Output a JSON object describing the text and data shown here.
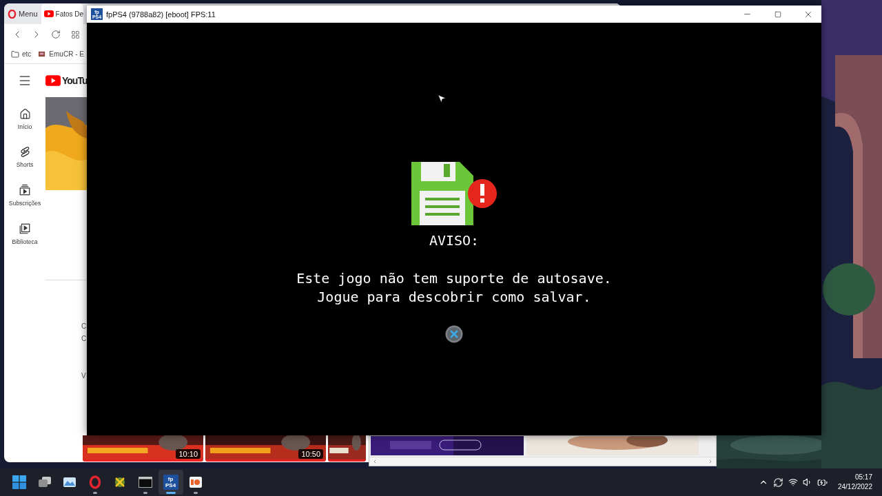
{
  "browser": {
    "tabs": [
      {
        "kind": "menu",
        "label": "Menu",
        "selected": false
      },
      {
        "kind": "page",
        "label": "Fatos De",
        "selected": true
      }
    ],
    "bookmarks": [
      {
        "kind": "folder",
        "label": "etc"
      },
      {
        "kind": "site",
        "label": "EmuCR - E"
      }
    ],
    "logo": "YouTu",
    "sidebar": [
      {
        "kind": "home",
        "label": "Início"
      },
      {
        "kind": "shorts",
        "label": "Shorts"
      },
      {
        "kind": "subscriptions",
        "label": "Subscrições"
      },
      {
        "kind": "library",
        "label": "Biblioteca"
      }
    ],
    "fragments": [
      "C",
      "C",
      "V"
    ],
    "videos": [
      {
        "kind": "picture",
        "duration": "10:10"
      },
      {
        "kind": "picture",
        "duration": "10:50"
      },
      {
        "kind": "picture"
      }
    ]
  },
  "emulator": {
    "title": "fpPS4 (9788a82) [eboot] FPS:11",
    "icon_text": [
      "fp",
      "PS4"
    ],
    "dialog": {
      "heading": "AVISO:",
      "lines": [
        "Este jogo não tem suporte de autosave.",
        "Jogue para descobrir como salvar."
      ]
    }
  },
  "taskbar": {
    "apps": [
      {
        "kind": "start",
        "running": false,
        "selected": false
      },
      {
        "kind": "taskview",
        "running": false,
        "selected": false
      },
      {
        "kind": "photos",
        "running": false,
        "selected": false
      },
      {
        "kind": "opera",
        "running": true,
        "selected": false
      },
      {
        "kind": "downloader",
        "running": false,
        "selected": false
      },
      {
        "kind": "terminal",
        "running": true,
        "selected": false
      },
      {
        "kind": "fpps4",
        "running": true,
        "selected": true,
        "icon_text": [
          "fp",
          "PS4"
        ]
      },
      {
        "kind": "presenter",
        "running": true,
        "selected": false
      }
    ],
    "time": "05:17",
    "date": "24/12/2022"
  }
}
